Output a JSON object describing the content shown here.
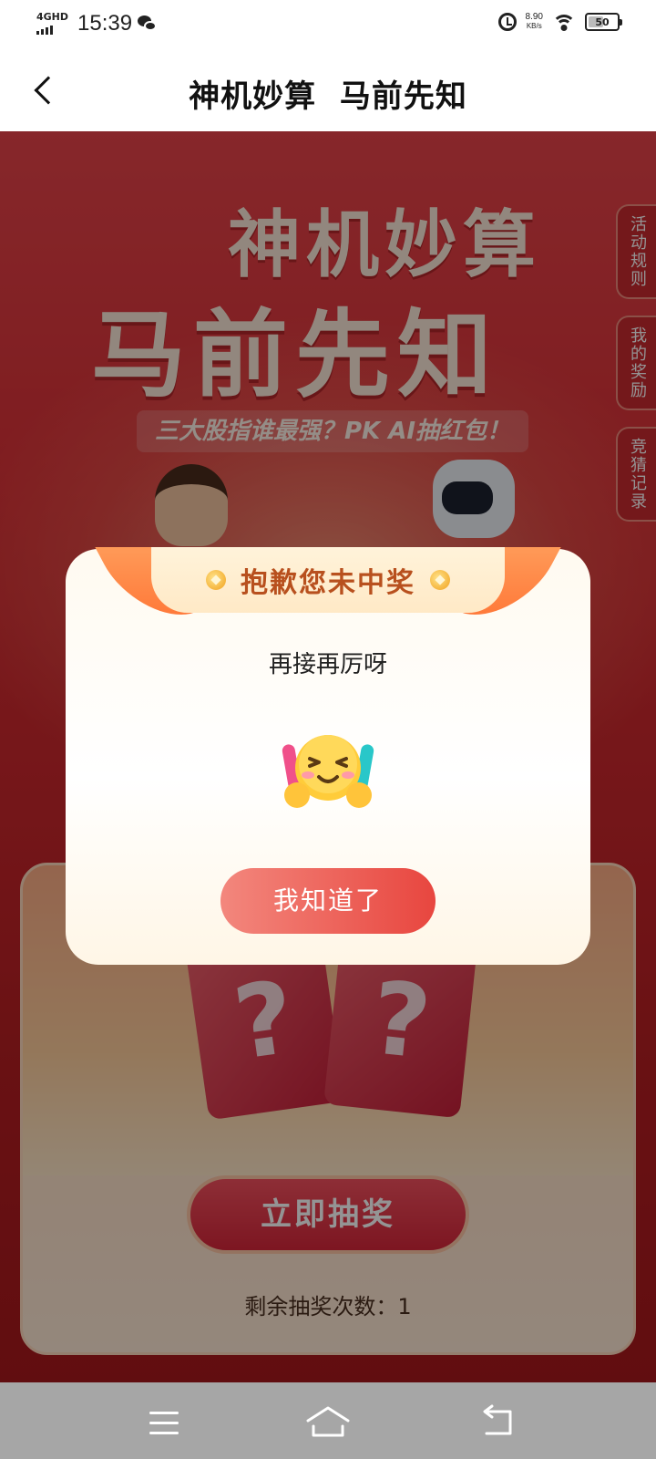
{
  "status_bar": {
    "network": "4GHD",
    "time": "15:39",
    "speed_value": "8.90",
    "speed_unit": "KB/s",
    "battery": "50"
  },
  "nav": {
    "title": "神机妙算  马前先知"
  },
  "hero": {
    "title_line1": "神机妙算",
    "title_line2": "马前先知",
    "subtitle": "三大股指谁最强？PK AI抽红包！"
  },
  "side_tabs": [
    "活动规则",
    "我的奖励",
    "竞猜记录"
  ],
  "lottery": {
    "draw_label": "立即抽奖",
    "remaining_text": "剩余抽奖次数：1",
    "mystery_symbol": "?"
  },
  "dialog": {
    "title": "抱歉您未中奖",
    "message": "再接再厉呀",
    "emoji_icon": "cheering-smiley-icon",
    "confirm_label": "我知道了"
  },
  "colors": {
    "page_red": "#d92f35",
    "ribbon_orange": "#ff7a3a",
    "dialog_title": "#b8501e",
    "button_red": "#e8463f"
  }
}
